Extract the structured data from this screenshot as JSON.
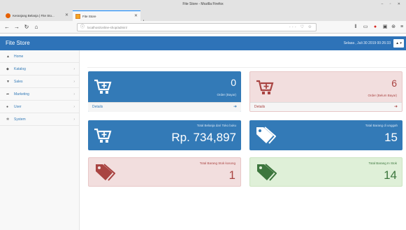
{
  "browser": {
    "window_title": "Fite Store - Mozilla Firefox",
    "tabs": [
      {
        "label": "Keranjang Belanja | Fite Sto..."
      },
      {
        "label": "Fite Store"
      }
    ],
    "url": "localhost/online-shop/admin/",
    "url_actions": "··· ♡ ☆"
  },
  "app": {
    "brand": "Fite Store",
    "datetime": "Selasa , Juli 30 2019 00:26:33",
    "user_menu": "▲ ▾"
  },
  "sidebar": {
    "items": [
      {
        "label": "Home",
        "icon": "home-icon",
        "has_submenu": false
      },
      {
        "label": "Katalog",
        "icon": "tag-icon",
        "has_submenu": true
      },
      {
        "label": "Sales",
        "icon": "cart-icon",
        "has_submenu": true
      },
      {
        "label": "Marketing",
        "icon": "share-icon",
        "has_submenu": true
      },
      {
        "label": "User",
        "icon": "user-icon",
        "has_submenu": true
      },
      {
        "label": "System",
        "icon": "cogs-icon",
        "has_submenu": true
      }
    ]
  },
  "cards": {
    "order_paid": {
      "value": "0",
      "label": "Order (Bayar)",
      "footer": "Details"
    },
    "order_unpaid": {
      "value": "6",
      "label": "Order (Belum Bayar)",
      "footer": "Details"
    },
    "total_spend": {
      "value": "Rp. 734,897",
      "label": "Total Belanja dari Toko buku"
    },
    "total_items": {
      "value": "15",
      "label": "Total Barang di unggah"
    },
    "empty_stock": {
      "value": "1",
      "label": "Total Barang Stok kosong"
    },
    "in_stock": {
      "value": "14",
      "label": "Total Barang In Stok"
    }
  },
  "colors": {
    "primary": "#337ab7",
    "danger_bg": "#f2dede",
    "danger_text": "#a94442",
    "success_bg": "#dff0d8",
    "success_text": "#3c763d"
  }
}
